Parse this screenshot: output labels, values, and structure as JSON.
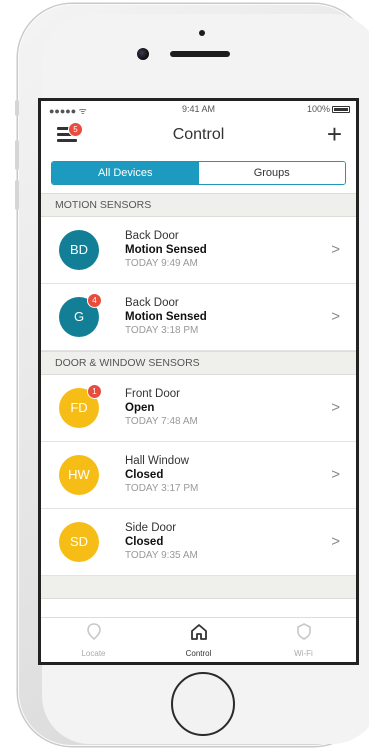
{
  "status_bar": {
    "signal": "●●●●● ᯤ",
    "time": "9:41 AM",
    "battery": "100%"
  },
  "header": {
    "title": "Control",
    "menu_badge": "5",
    "add_label": "+"
  },
  "segments": [
    {
      "label": "All Devices",
      "active": true
    },
    {
      "label": "Groups",
      "active": false
    }
  ],
  "sections": [
    {
      "title": "MOTION SENSORS",
      "items": [
        {
          "initials": "BD",
          "color": "#127f97",
          "badge": "",
          "name": "Back Door",
          "state": "Motion Sensed",
          "time": "TODAY 9:49 AM"
        },
        {
          "initials": "G",
          "color": "#127f97",
          "badge": "4",
          "name": "Back Door",
          "state": "Motion Sensed",
          "time": "TODAY 3:18 PM"
        }
      ]
    },
    {
      "title": "DOOR & WINDOW SENSORS",
      "items": [
        {
          "initials": "FD",
          "color": "#f7bd17",
          "badge": "1",
          "name": "Front Door",
          "state": "Open",
          "time": "TODAY 7:48 AM"
        },
        {
          "initials": "HW",
          "color": "#f7bd17",
          "badge": "",
          "name": "Hall Window",
          "state": "Closed",
          "time": "TODAY 3:17 PM"
        },
        {
          "initials": "SD",
          "color": "#f7bd17",
          "badge": "",
          "name": "Side Door",
          "state": "Closed",
          "time": "TODAY 9:35 AM"
        }
      ]
    }
  ],
  "tabbar": [
    {
      "label": "Locate",
      "icon": "location-pin-icon",
      "active": false
    },
    {
      "label": "Control",
      "icon": "home-icon",
      "active": true
    },
    {
      "label": "Wi-Fi",
      "icon": "shield-icon",
      "active": false
    }
  ],
  "colors": {
    "accent": "#1c9ac0",
    "badge": "#e84c3d",
    "motion_avatar": "#127f97",
    "door_avatar": "#f7bd17"
  }
}
